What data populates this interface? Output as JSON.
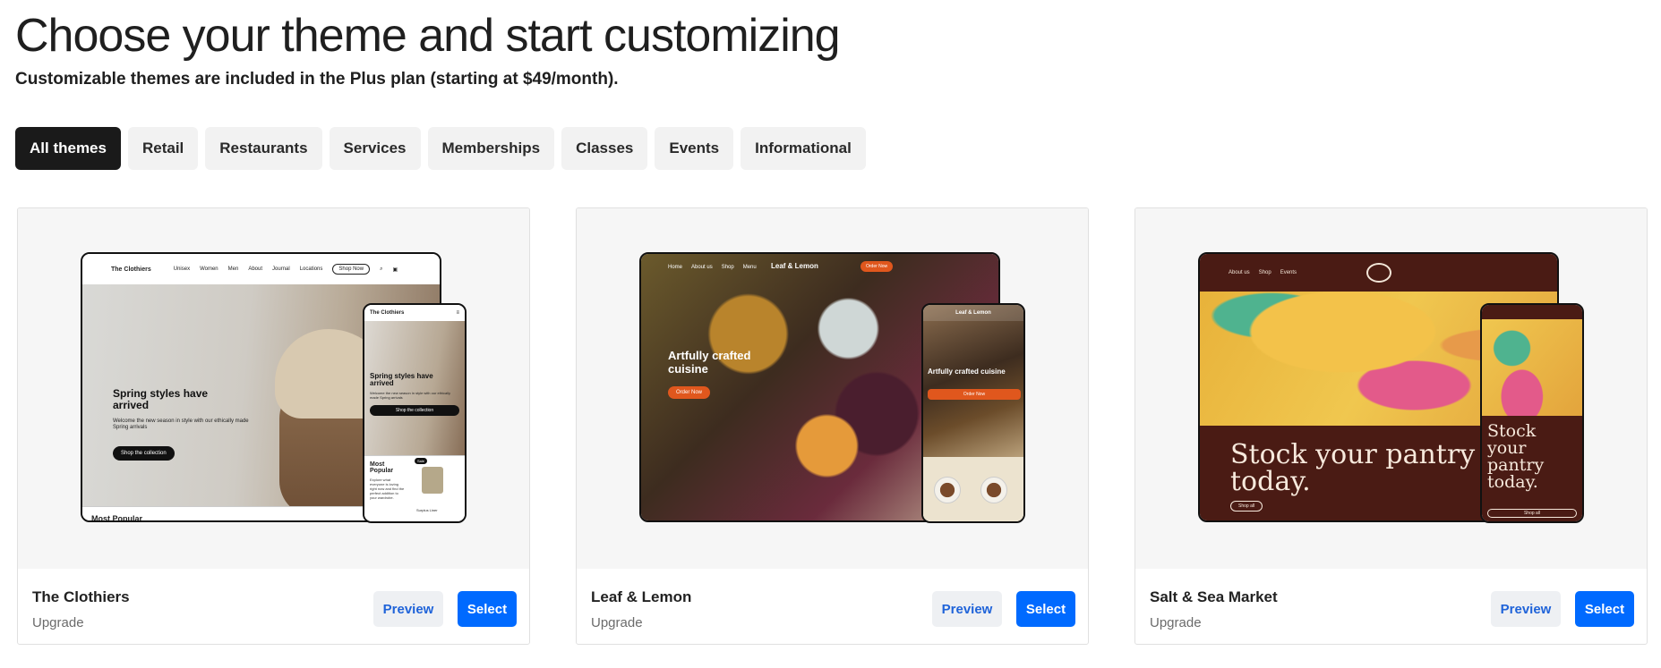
{
  "header": {
    "title": "Choose your theme and start customizing",
    "subtitle": "Customizable themes are included in the Plus plan (starting at $49/month)."
  },
  "filters": [
    {
      "label": "All themes",
      "active": true
    },
    {
      "label": "Retail",
      "active": false
    },
    {
      "label": "Restaurants",
      "active": false
    },
    {
      "label": "Services",
      "active": false
    },
    {
      "label": "Memberships",
      "active": false
    },
    {
      "label": "Classes",
      "active": false
    },
    {
      "label": "Events",
      "active": false
    },
    {
      "label": "Informational",
      "active": false
    }
  ],
  "themes": [
    {
      "name": "The Clothiers",
      "tier": "Upgrade",
      "preview_label": "Preview",
      "select_label": "Select",
      "mock": {
        "brand": "The Clothiers",
        "nav": [
          "Unisex",
          "Women",
          "Men",
          "About",
          "Journal",
          "Locations"
        ],
        "shop_now": "Shop Now",
        "hero_title": "Spring styles have arrived",
        "hero_text": "Welcome the new season in style with our ethically made Spring arrivals",
        "hero_button": "Shop the collection",
        "section_title": "Most Popular",
        "section_text": "Explore what everyone is loving right now and find the perfect addition to your wardrobe.",
        "sale_badge": "Sale",
        "product_name": "Surplus Liner"
      }
    },
    {
      "name": "Leaf & Lemon",
      "tier": "Upgrade",
      "preview_label": "Preview",
      "select_label": "Select",
      "mock": {
        "brand": "Leaf & Lemon",
        "nav": [
          "Home",
          "About us",
          "Shop",
          "Menu"
        ],
        "order_button": "Order Now",
        "hero_title": "Artfully crafted cuisine",
        "hero_button": "Order Now"
      }
    },
    {
      "name": "Salt & Sea Market",
      "tier": "Upgrade",
      "preview_label": "Preview",
      "select_label": "Select",
      "mock": {
        "nav": [
          "About us",
          "Shop",
          "Events"
        ],
        "hero_title": "Stock your pantry today.",
        "hero_button": "Shop all"
      }
    }
  ]
}
